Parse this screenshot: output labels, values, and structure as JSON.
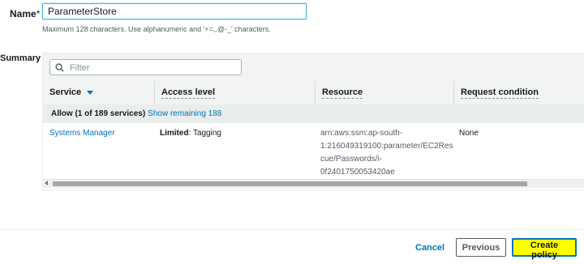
{
  "form": {
    "name_label": "Name",
    "required_mark": "*",
    "name_value": "ParameterStore",
    "name_hint": "Maximum 128 characters. Use alphanumeric and '+=,.@-_' characters."
  },
  "summary": {
    "label": "Summary",
    "filter_placeholder": "Filter",
    "columns": [
      "Service",
      "Access level",
      "Resource",
      "Request condition"
    ],
    "group": {
      "allow_text": "Allow (1 of 189 services)",
      "show_remaining": "Show remaining 188"
    },
    "rows": [
      {
        "service": "Systems Manager",
        "access_bold": "Limited",
        "access_rest": ": Tagging",
        "resource_lines": [
          "arn:aws:ssm:ap-south-",
          "1:216049319100:parameter/EC2Res",
          "cue/Passwords/i-",
          "0f2401750053420ae"
        ],
        "condition": "None"
      }
    ]
  },
  "footer": {
    "cancel": "Cancel",
    "previous": "Previous",
    "create": "Create policy"
  },
  "colors": {
    "accent": "#0073bb",
    "create_button_bg": "#ffff00"
  }
}
